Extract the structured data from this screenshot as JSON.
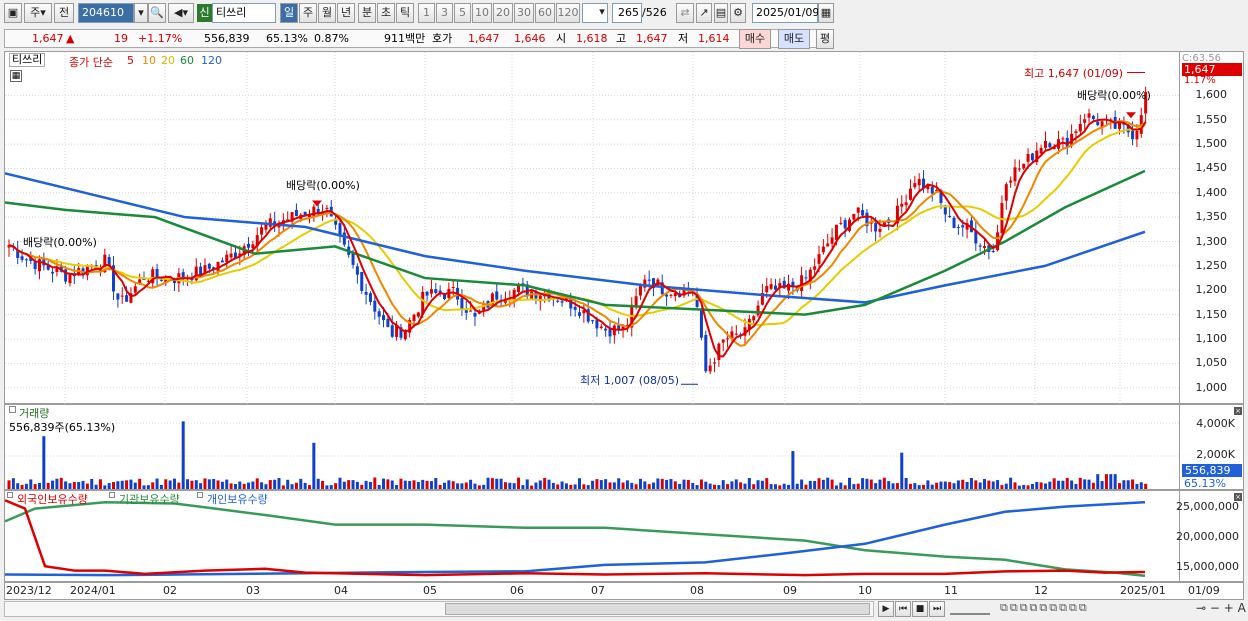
{
  "toolbar": {
    "period_prefix": "주",
    "prev_label": "전",
    "code": "204610",
    "stock_badge": "신",
    "stock_name": "티쓰리",
    "period_tabs": [
      "일",
      "주",
      "월",
      "년",
      "분",
      "초",
      "틱"
    ],
    "periods": [
      "1",
      "3",
      "5",
      "10",
      "20",
      "30",
      "60",
      "120"
    ],
    "count": "265",
    "total": "/526",
    "date": "2025/01/09"
  },
  "quote": {
    "price": "1,647",
    "change": "19",
    "change_pct": "+1.17%",
    "volume": "556,839",
    "vol_ratio": "65.13%",
    "turnover_rate": "0.87%",
    "amount": "911백만",
    "bid_label": "호가",
    "ask": "1,647",
    "bid": "1,646",
    "open_label": "시",
    "open": "1,618",
    "high_label": "고",
    "high": "1,647",
    "low_label": "저",
    "low": "1,614",
    "buy_label": "매수",
    "sell_label": "매도",
    "avg_label": "평"
  },
  "legend": {
    "name": "티쓰리",
    "ma_label": "종가 단순",
    "ma": [
      "5",
      "10",
      "20",
      "60",
      "120"
    ]
  },
  "colors": {
    "ma5": "#dd0000",
    "ma10": "#ee8800",
    "ma20": "#e6cc00",
    "ma60": "#1a8a3a",
    "ma120": "#2060d8",
    "up": "#dd0000",
    "down": "#1040c8",
    "bg": "#ffffff"
  },
  "annotations": {
    "high": "최고 1,647 (01/09)",
    "low": "최저 1,007 (08/05)",
    "div1": "배당락(0.00%)",
    "div2": "배당락(0.00%)",
    "div3": "배당락(0.00%)"
  },
  "price_axis": {
    "top": "C:63.56",
    "current": "1,647",
    "pct": "1.17%",
    "ticks": [
      "1,600",
      "1,550",
      "1,500",
      "1,450",
      "1,400",
      "1,350",
      "1,300",
      "1,250",
      "1,200",
      "1,150",
      "1,100",
      "1,050",
      "1,000"
    ]
  },
  "volume": {
    "title": "거래량",
    "value": "556,839주(65.13%)",
    "ticks": [
      "4,000K",
      "2,000K"
    ],
    "current": "556,839",
    "pct": "65.13%"
  },
  "holdings": {
    "series": [
      "외국인보유수량",
      "기관보유수량",
      "개인보유수량"
    ],
    "ticks": [
      "25,000,000",
      "20,000,000",
      "15,000,000"
    ]
  },
  "x_axis": [
    "2023/12",
    "2024/01",
    "02",
    "03",
    "04",
    "05",
    "06",
    "07",
    "08",
    "09",
    "10",
    "11",
    "12",
    "2025/01",
    "01/09"
  ]
}
